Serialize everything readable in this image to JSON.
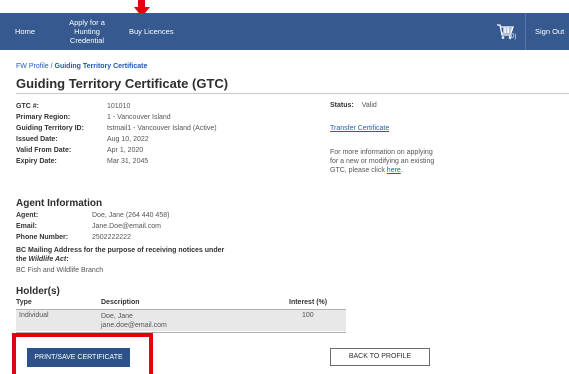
{
  "nav": {
    "home": "Home",
    "hunting": "Apply for a Hunting Credential",
    "buy": "Buy Licences",
    "cart_count": "(0)",
    "sign_out": "Sign Out"
  },
  "breadcrumb": {
    "root": "FW Profile",
    "separator": " / ",
    "current": "Guiding Territory Certificate"
  },
  "page_title": "Guiding Territory Certificate (GTC)",
  "details": [
    {
      "label": "GTC #:",
      "value": "101010"
    },
    {
      "label": "Primary Region:",
      "value": "1 - Vancouver Island"
    },
    {
      "label": "Guiding Territory ID:",
      "value": "tstmail1 - Vancouver Island (Active)"
    },
    {
      "label": "Issued Date:",
      "value": "Aug 10, 2022"
    },
    {
      "label": "Valid From Date:",
      "value": "Apr 1, 2020"
    },
    {
      "label": "Expiry Date:",
      "value": "Mar 31, 2045"
    }
  ],
  "status": {
    "label": "Status:",
    "value": "Valid"
  },
  "transfer_link": "Transfer Certificate",
  "info": {
    "text": "For more information on applying for a new or modifying an existing GTC, please click ",
    "link": "here",
    "end": "."
  },
  "agent": {
    "heading": "Agent Information",
    "rows": [
      {
        "label": "Agent:",
        "value": "Doe, Jane (264 440 458)"
      },
      {
        "label": "Email:",
        "value": "Jane.Doe@email.com"
      },
      {
        "label": "Phone Number:",
        "value": "2502222222"
      }
    ],
    "mailing_label_a": "BC Mailing Address for the purpose of receiving notices under the ",
    "mailing_label_italic": "Wildlife Act",
    "mailing_label_b": ":",
    "mailing_value": "BC Fish and Wildlife Branch"
  },
  "holders": {
    "heading": "Holder(s)",
    "columns": [
      "Type",
      "Description",
      "Interest (%)"
    ],
    "rows": [
      {
        "type": "Individual",
        "name": "Doe, Jane",
        "email": "jane.doe@email.com",
        "interest": "100"
      }
    ]
  },
  "buttons": {
    "print": "PRINT/SAVE CERTIFICATE",
    "back": "BACK TO PROFILE"
  },
  "colors": {
    "nav_bg": "#36598f",
    "link": "#2360b3",
    "primary_button": "#2d5189",
    "annotation_red": "#e3000f"
  }
}
